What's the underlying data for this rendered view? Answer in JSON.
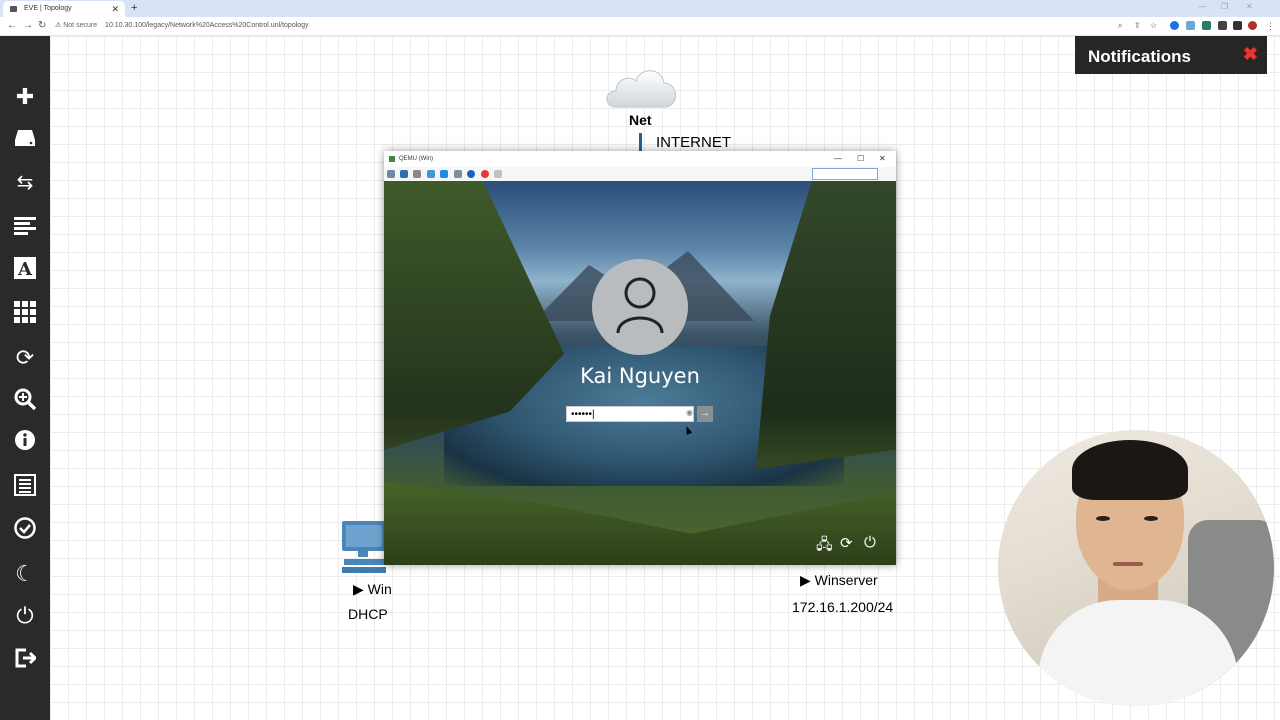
{
  "browser": {
    "tab_title": "EVE | Topology",
    "new_tab": "+",
    "not_secure": "Not secure",
    "url": "10.10.30.100/legacy/Network%20Access%20Control.unl/topology"
  },
  "sidebar": {
    "items": [
      {
        "icon": "plus-icon"
      },
      {
        "icon": "drive-icon"
      },
      {
        "icon": "swap-icon"
      },
      {
        "icon": "align-left-icon"
      },
      {
        "icon": "text-icon"
      },
      {
        "icon": "grid-icon"
      },
      {
        "icon": "refresh-icon"
      },
      {
        "icon": "zoom-icon"
      },
      {
        "icon": "info-icon"
      },
      {
        "icon": "list-icon"
      },
      {
        "icon": "check-circle-icon"
      },
      {
        "icon": "moon-icon"
      },
      {
        "icon": "power-icon"
      },
      {
        "icon": "logout-icon"
      }
    ]
  },
  "topology": {
    "cloud_label": "Net",
    "link_label": "INTERNET",
    "win_node": "Win",
    "win_sub": "DHCP",
    "winserver_node": "Winserver",
    "winserver_ip": "172.16.1.200/24"
  },
  "notifications": {
    "title": "Notifications",
    "close": "✖"
  },
  "qemu": {
    "title": "QEMU (Win)",
    "login": {
      "username": "Kai Nguyen",
      "password_value": "••••••|"
    }
  },
  "colors": {
    "sidebar_bg": "#2a2a2a",
    "notif_bg": "#262626",
    "notif_close": "#ee3333",
    "link": "#2c5f8a",
    "pc_color": "#3d7bb0"
  }
}
